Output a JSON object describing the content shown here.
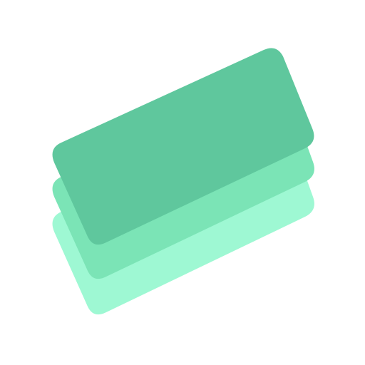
{
  "icon": {
    "name": "stacked-cards-icon",
    "layers": [
      {
        "name": "card-layer-back",
        "color": "#9EF8D3"
      },
      {
        "name": "card-layer-middle",
        "color": "#7BE4B6"
      },
      {
        "name": "card-layer-front",
        "color": "#5FC79D"
      }
    ]
  }
}
